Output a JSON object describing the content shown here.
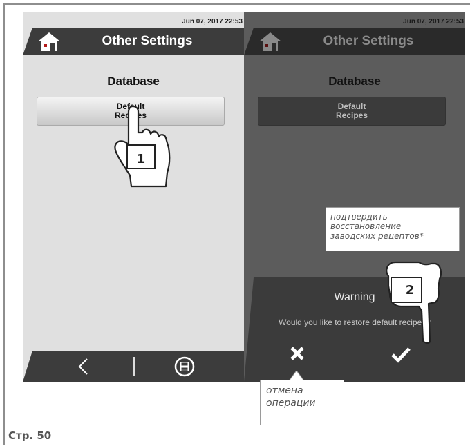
{
  "page": {
    "footer_label": "Стр. 50"
  },
  "screen_left": {
    "date": "Jun 07, 2017  22:53",
    "title": "Other Settings",
    "section": "Database",
    "button_label": "Default\nRecipes",
    "icons": [
      "home-icon",
      "back-chevron-icon",
      "save-disk-icon"
    ]
  },
  "screen_right": {
    "date": "Jun 07, 2017  22:53",
    "title": "Other Settings",
    "section": "Database",
    "button_label": "Default\nRecipes",
    "dialog": {
      "title": "Warning",
      "message": "Would you like to restore default recipes?",
      "cancel_icon": "close-icon",
      "confirm_icon": "check-icon"
    }
  },
  "annotations": {
    "step1": "1",
    "step2": "2",
    "confirm_callout": "подтвердить\nвосстановление\nзаводских рецептов*",
    "cancel_callout": "отмена\nоперации"
  },
  "colors": {
    "header_bg": "#3c3c3c",
    "screen_bg": "#e0e0e0",
    "dim_bg": "#5c5c5c"
  }
}
